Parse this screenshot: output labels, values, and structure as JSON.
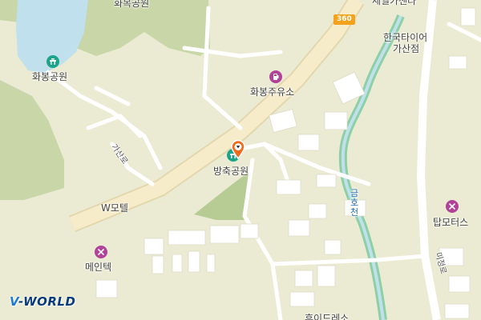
{
  "labels": {
    "hwamok_park": "화목공원",
    "hwabong_park": "화봉공원",
    "hwabong_gas": "화봉주유소",
    "bangchuk_park": "방축공원",
    "gasan_ro": "가산로",
    "w_motel": "W모텔",
    "meintech": "메인텍",
    "sejeon_center": "세일카센타",
    "korea_tire": "한국타이어",
    "gasan_branch": "가산점",
    "geumho_stream": "금호천",
    "top_motors": "탑모터스",
    "mijeong_ro": "미정로",
    "bottom_partial": "휴이드레소",
    "route_number": "360"
  },
  "branding": {
    "logo_prefix": "V",
    "logo_text": "-WORLD"
  },
  "colors": {
    "land": "#ebebd4",
    "forest": "#c9d6a8",
    "water": "#bfe0ec",
    "stream": "#8ed0a6",
    "major_road": "#f6ecc9",
    "road": "#ffffff",
    "building": "#ffffff",
    "poi_green": "#1aa58b",
    "poi_pink": "#b0429a",
    "marker": "#f26b1d"
  },
  "icons": {
    "park": "park-icon",
    "gas": "fuel-icon",
    "repair": "wrench-icon",
    "marker": "location-marker-icon"
  }
}
